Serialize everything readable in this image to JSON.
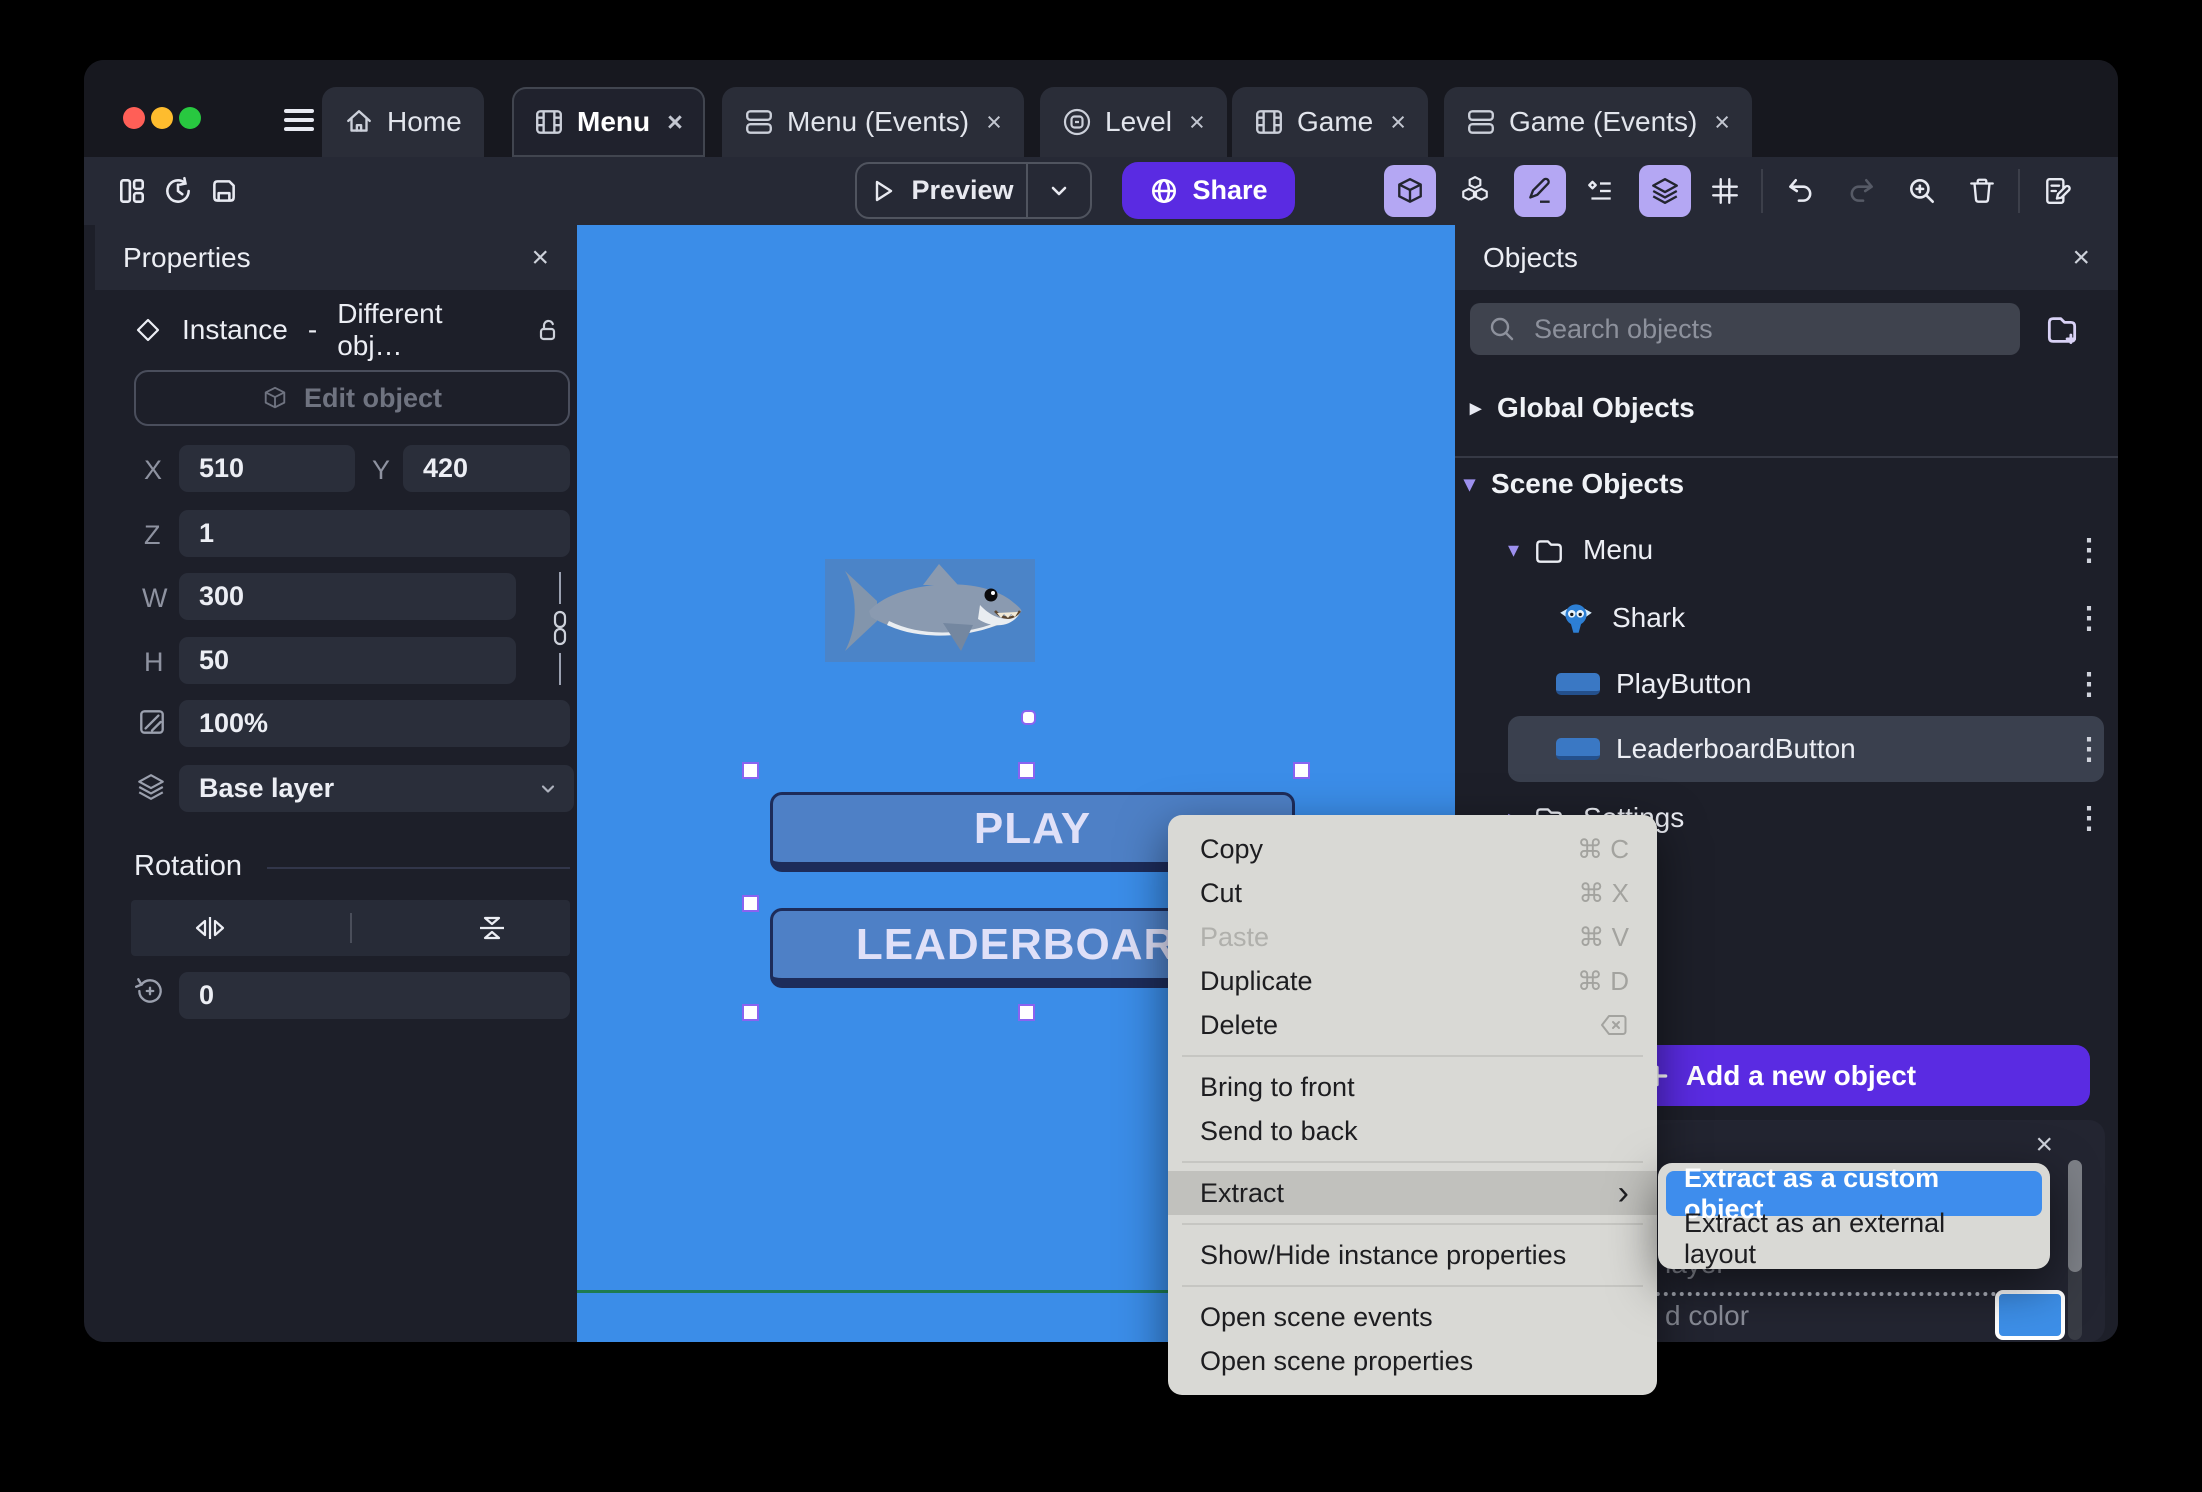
{
  "tabs": [
    {
      "label": "Home"
    },
    {
      "label": "Menu"
    },
    {
      "label": "Menu (Events)"
    },
    {
      "label": "Level"
    },
    {
      "label": "Game"
    },
    {
      "label": "Game (Events)"
    }
  ],
  "toolbar": {
    "preview_label": "Preview",
    "share_label": "Share"
  },
  "properties": {
    "title": "Properties",
    "instance_type": "Instance",
    "instance_separator": "-",
    "instance_value": "Different obj…",
    "edit_object_label": "Edit object",
    "x_label": "X",
    "x_value": "510",
    "y_label": "Y",
    "y_value": "420",
    "z_label": "Z",
    "z_value": "1",
    "w_label": "W",
    "w_value": "300",
    "h_label": "H",
    "h_value": "50",
    "opacity_value": "100%",
    "layer_value": "Base layer",
    "rotation_title": "Rotation",
    "rotation_value": "0"
  },
  "canvas": {
    "play_button_label": "PLAY",
    "leaderboard_button_label": "LEADERBOARD"
  },
  "objects": {
    "title": "Objects",
    "search_placeholder": "Search objects",
    "global_section": "Global Objects",
    "scene_section": "Scene Objects",
    "tree": [
      {
        "label": "Menu",
        "type": "folder",
        "expanded": true
      },
      {
        "label": "Shark",
        "type": "sprite"
      },
      {
        "label": "PlayButton",
        "type": "button"
      },
      {
        "label": "LeaderboardButton",
        "type": "button",
        "selected": true
      },
      {
        "label": "Settings",
        "type": "folder",
        "expanded": false
      }
    ],
    "add_button_label": "Add a new object",
    "footer": {
      "layer_text": "layer",
      "color_text": "d color"
    }
  },
  "context_menu": {
    "items": [
      {
        "label": "Copy",
        "shortcut": "⌘ C"
      },
      {
        "label": "Cut",
        "shortcut": "⌘ X"
      },
      {
        "label": "Paste",
        "shortcut": "⌘ V",
        "disabled": true
      },
      {
        "label": "Duplicate",
        "shortcut": "⌘ D"
      },
      {
        "label": "Delete",
        "shortcut": ""
      },
      {
        "label": "Bring to front"
      },
      {
        "label": "Send to back"
      },
      {
        "label": "Extract",
        "highlighted": true,
        "has_submenu": true
      },
      {
        "label": "Show/Hide instance properties"
      },
      {
        "label": "Open scene events"
      },
      {
        "label": "Open scene properties"
      }
    ]
  },
  "submenu": {
    "items": [
      {
        "label": "Extract as a custom object",
        "highlighted": true
      },
      {
        "label": "Extract as an external layout"
      }
    ]
  },
  "colors": {
    "canvas_blue": "#3b8de8",
    "accent_purple": "#5a2be2",
    "toolbar_toggle_purple": "#b4a7f3",
    "menu_highlight_blue": "#3e8ded",
    "game_button_blue": "#4e80c6",
    "selection_handle_purple": "#8a63f0",
    "scene_bound_green": "#1e7b50",
    "swatch_blue": "#3d8fe8"
  }
}
